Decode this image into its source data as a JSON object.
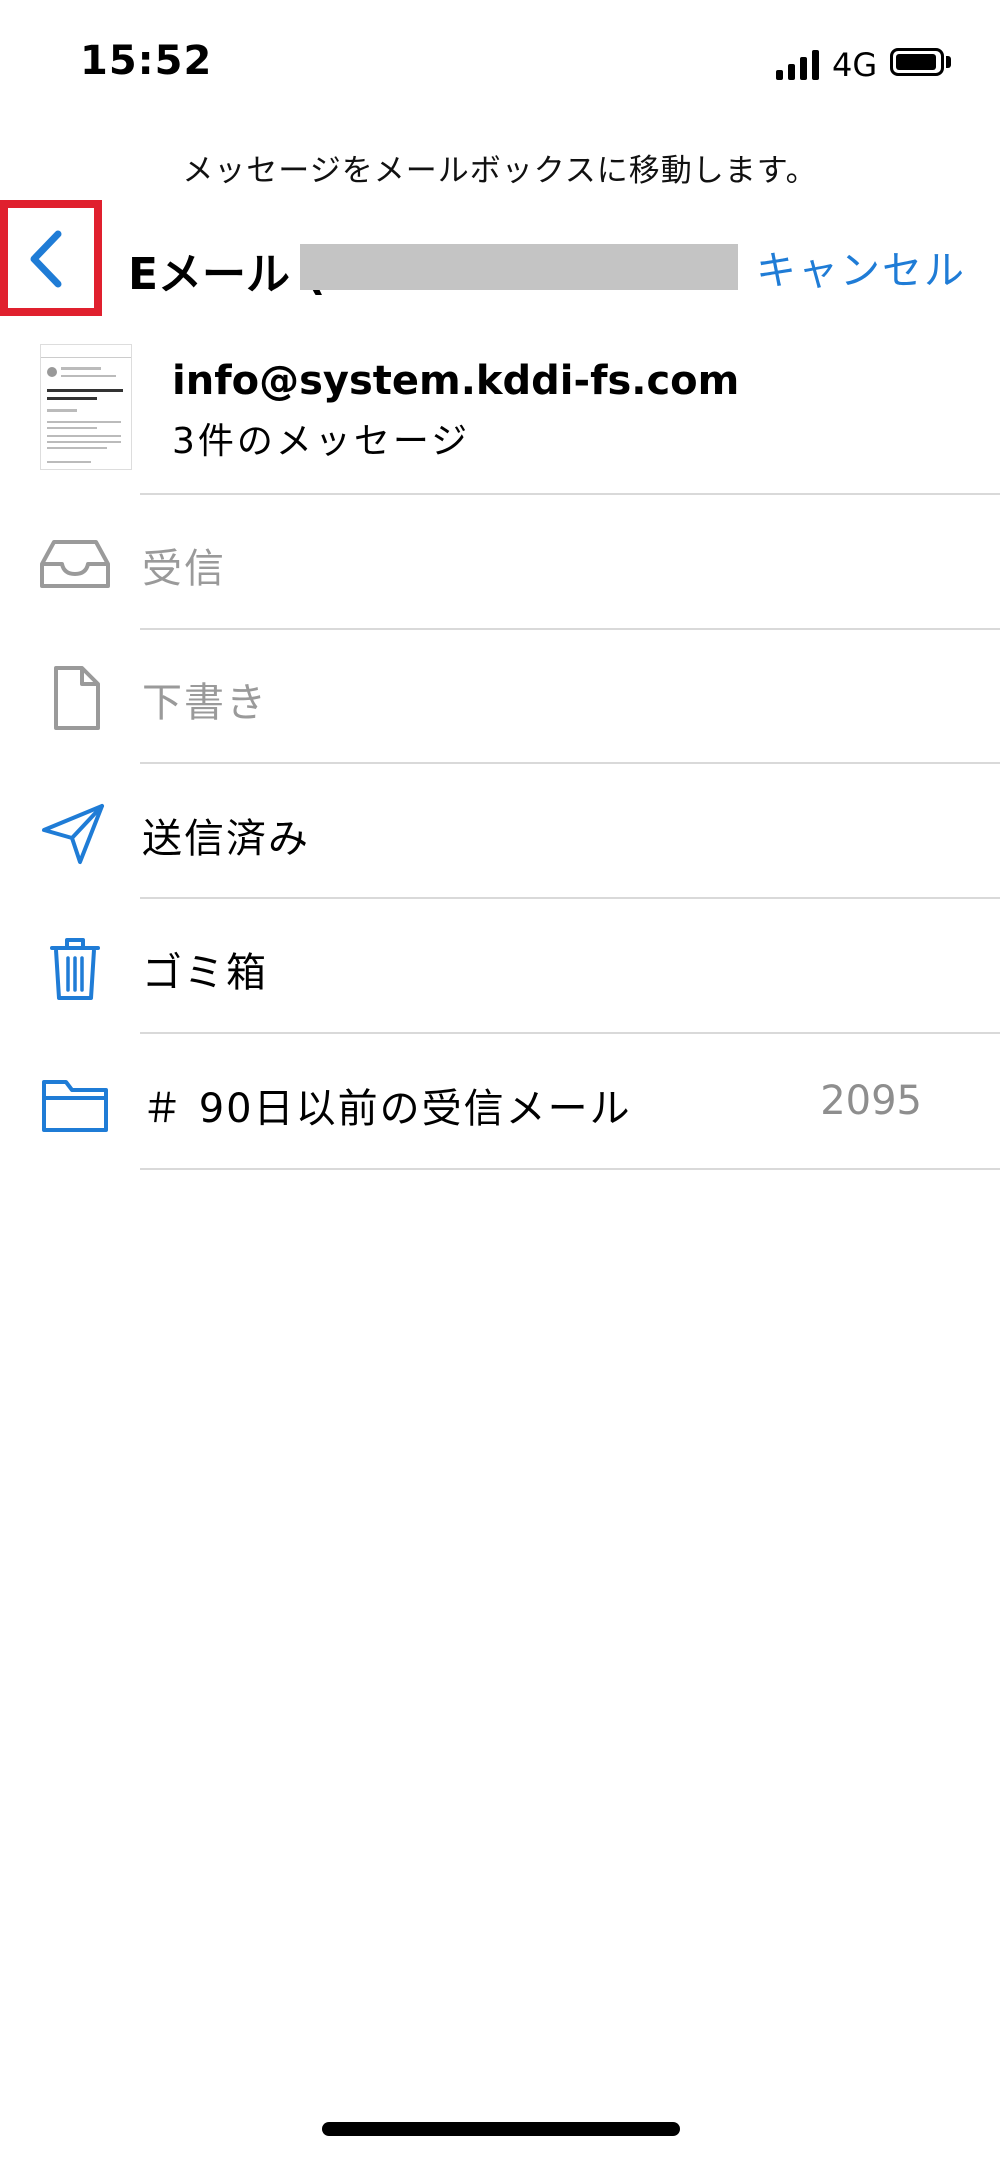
{
  "status": {
    "time": "15:52",
    "network": "4G"
  },
  "instruction": "メッセージをメールボックスに移動します。",
  "header": {
    "title": "Eメール (",
    "cancel": "キャンセル"
  },
  "message": {
    "sender": "info@system.kddi-fs.com",
    "count_text": "3件のメッセージ"
  },
  "mailboxes": [
    {
      "label": "受信",
      "icon": "inbox-icon",
      "enabled": false
    },
    {
      "label": "下書き",
      "icon": "document-icon",
      "enabled": false
    },
    {
      "label": "送信済み",
      "icon": "paper-plane-icon",
      "enabled": true
    },
    {
      "label": "ゴミ箱",
      "icon": "trash-icon",
      "enabled": true
    },
    {
      "label": "＃ 90日以前の受信メール",
      "icon": "folder-icon",
      "enabled": true,
      "count": "2095"
    }
  ],
  "colors": {
    "accent": "#1f7cd6",
    "highlight": "#e0202e",
    "disabled": "#9a9a9a"
  }
}
